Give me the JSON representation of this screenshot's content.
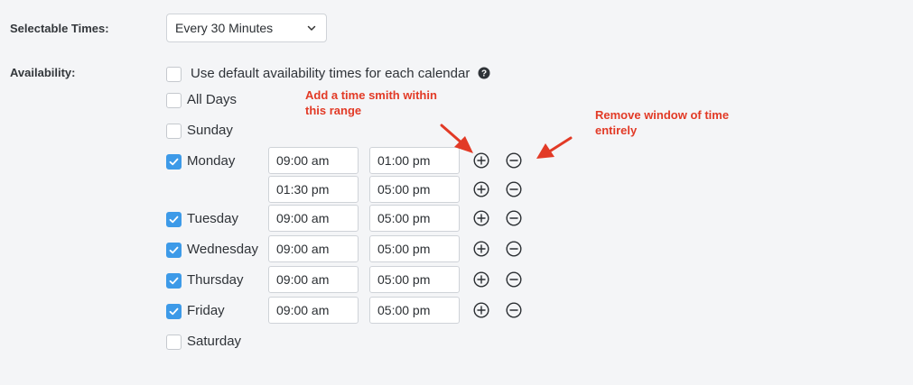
{
  "labels": {
    "selectable_times": "Selectable Times:",
    "availability": "Availability:"
  },
  "select": {
    "value": "Every 30 Minutes"
  },
  "options": {
    "default_times": "Use default availability times for each calendar",
    "all_days": "All Days",
    "sunday": "Sunday",
    "saturday": "Saturday"
  },
  "days": [
    {
      "label": "Monday",
      "checked": true,
      "ranges": [
        {
          "start": "09:00 am",
          "end": "01:00 pm"
        },
        {
          "start": "01:30 pm",
          "end": "05:00 pm"
        }
      ]
    },
    {
      "label": "Tuesday",
      "checked": true,
      "ranges": [
        {
          "start": "09:00 am",
          "end": "05:00 pm"
        }
      ]
    },
    {
      "label": "Wednesday",
      "checked": true,
      "ranges": [
        {
          "start": "09:00 am",
          "end": "05:00 pm"
        }
      ]
    },
    {
      "label": "Thursday",
      "checked": true,
      "ranges": [
        {
          "start": "09:00 am",
          "end": "05:00 pm"
        }
      ]
    },
    {
      "label": "Friday",
      "checked": true,
      "ranges": [
        {
          "start": "09:00 am",
          "end": "05:00 pm"
        }
      ]
    }
  ],
  "annotations": {
    "add_line1": "Add a time smith within",
    "add_line2": "this range",
    "remove_line1": "Remove window of time",
    "remove_line2": "entirely"
  },
  "colors": {
    "accent": "#3d9ae8",
    "annotation": "#e23a26",
    "background": "#f4f5f7"
  },
  "icons": {
    "add": "plus-circle-icon",
    "remove": "minus-circle-icon",
    "help": "question-circle-icon",
    "dropdown": "chevron-down-icon",
    "check": "check-icon"
  }
}
